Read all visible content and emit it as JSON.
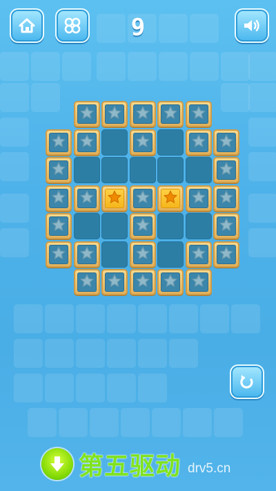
{
  "level": {
    "number": "9"
  },
  "top_bar": {
    "home_icon": "house-icon",
    "menu_icon": "four-leaf-grid-icon",
    "sound_icon": "speaker-icon"
  },
  "board": {
    "rows": [
      [
        0,
        1,
        1,
        1,
        1,
        1,
        0
      ],
      [
        1,
        1,
        2,
        1,
        2,
        1,
        1
      ],
      [
        1,
        2,
        2,
        2,
        2,
        2,
        1
      ],
      [
        1,
        1,
        3,
        1,
        3,
        1,
        1
      ],
      [
        1,
        2,
        2,
        1,
        2,
        2,
        1
      ],
      [
        1,
        1,
        2,
        1,
        2,
        1,
        1
      ],
      [
        0,
        1,
        1,
        1,
        1,
        1,
        0
      ]
    ],
    "cell_legend": {
      "0": "empty",
      "1": "star-tile",
      "2": "filled-slot",
      "3": "gold-star-tile"
    }
  },
  "controls": {
    "replay_icon": "undo-arrow-icon"
  },
  "watermark": {
    "brand": "第五驱动",
    "url": "drv5.cn",
    "logo_icon": "download-arrow-icon"
  },
  "colors": {
    "background": "#52b4ea",
    "tile_frame": "#e2b15b",
    "slot": "#2c7ea5",
    "gold_star": "#f5b51a",
    "watermark_green": "#7fe31f"
  }
}
